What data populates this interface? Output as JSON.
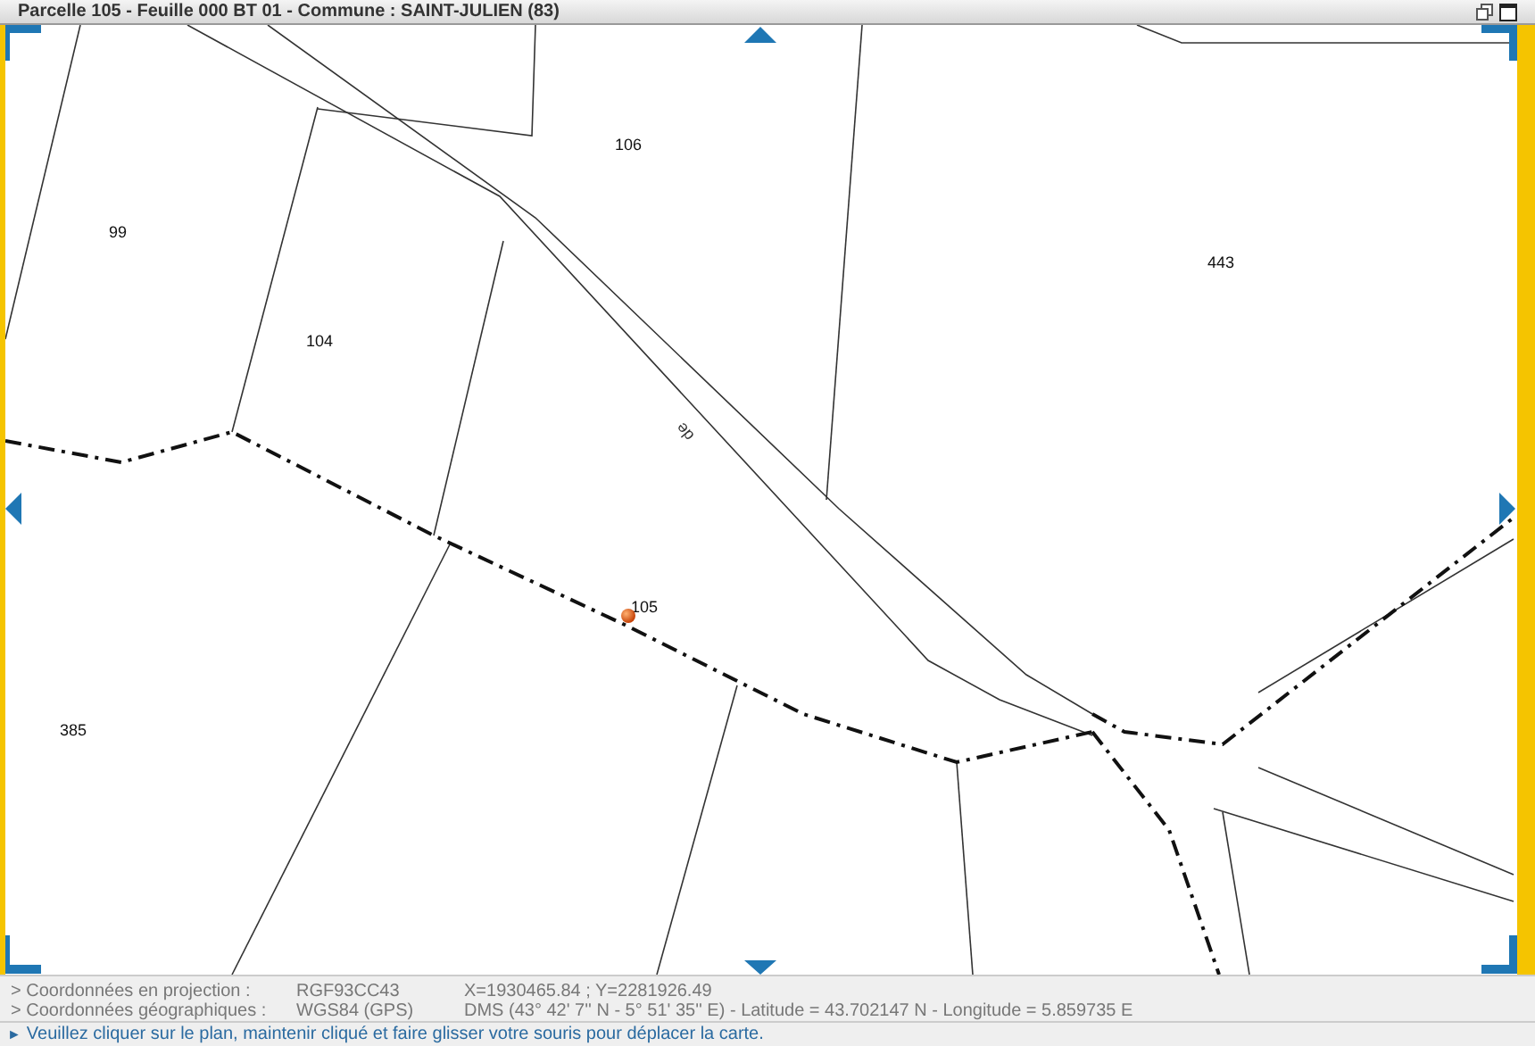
{
  "window": {
    "title": "Parcelle 105 - Feuille 000 BT 01 - Commune : SAINT-JULIEN (83)"
  },
  "map": {
    "parcel_labels": [
      "106",
      "99",
      "443",
      "104",
      "105",
      "385"
    ],
    "road_label": "de"
  },
  "status": {
    "rows": [
      {
        "label": "> Coordonnées en projection :",
        "system": "RGF93CC43",
        "value": "X=1930465.84 ; Y=2281926.49"
      },
      {
        "label": "> Coordonnées géographiques :",
        "system": "WGS84 (GPS)",
        "value": "DMS (43° 42' 7'' N - 5° 51' 35'' E) - Latitude = 43.702147 N - Longitude = 5.859735 E"
      }
    ],
    "hint": {
      "icon": "►",
      "text": "Veuillez cliquer sur le plan, maintenir cliqué et faire glisser votre souris pour déplacer la carte."
    }
  }
}
